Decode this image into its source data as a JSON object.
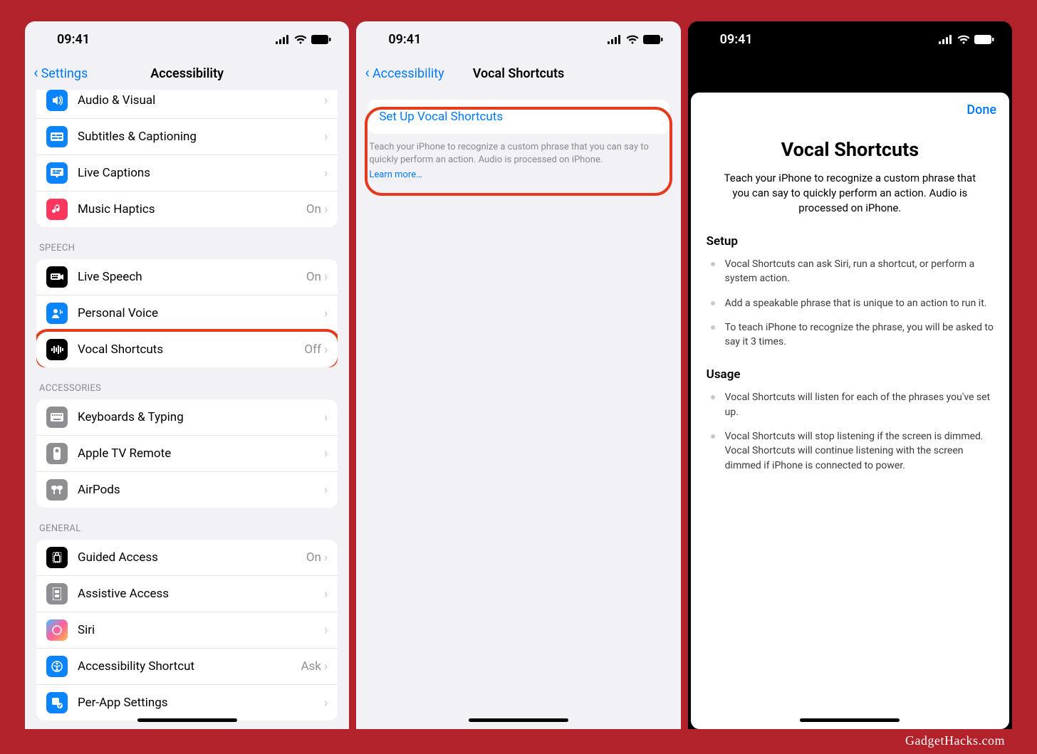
{
  "status": {
    "time": "09:41"
  },
  "watermark": "GadgetHacks.com",
  "phone1": {
    "back": "Settings",
    "title": "Accessibility",
    "truncated_row": {
      "label": "Audio & Visual"
    },
    "rows_top": [
      {
        "icon": "captions-icon",
        "label": "Subtitles & Captioning",
        "value": ""
      },
      {
        "icon": "live-captions-icon",
        "label": "Live Captions",
        "value": ""
      },
      {
        "icon": "music-haptics-icon",
        "label": "Music Haptics",
        "value": "On"
      }
    ],
    "speech_header": "SPEECH",
    "speech_rows": [
      {
        "icon": "live-speech-icon",
        "label": "Live Speech",
        "value": "On"
      },
      {
        "icon": "personal-voice-icon",
        "label": "Personal Voice",
        "value": ""
      },
      {
        "icon": "vocal-shortcuts-icon",
        "label": "Vocal Shortcuts",
        "value": "Off",
        "highlight": true
      }
    ],
    "accessories_header": "ACCESSORIES",
    "accessories_rows": [
      {
        "icon": "keyboard-icon",
        "label": "Keyboards & Typing",
        "value": ""
      },
      {
        "icon": "remote-icon",
        "label": "Apple TV Remote",
        "value": ""
      },
      {
        "icon": "airpods-icon",
        "label": "AirPods",
        "value": ""
      }
    ],
    "general_header": "GENERAL",
    "general_rows": [
      {
        "icon": "guided-access-icon",
        "label": "Guided Access",
        "value": "On"
      },
      {
        "icon": "assistive-access-icon",
        "label": "Assistive Access",
        "value": ""
      },
      {
        "icon": "siri-icon",
        "label": "Siri",
        "value": ""
      },
      {
        "icon": "accessibility-shortcut-icon",
        "label": "Accessibility Shortcut",
        "value": "Ask"
      },
      {
        "icon": "per-app-icon",
        "label": "Per-App Settings",
        "value": ""
      }
    ]
  },
  "phone2": {
    "back": "Accessibility",
    "title": "Vocal Shortcuts",
    "setup_label": "Set Up Vocal Shortcuts",
    "footer": "Teach your iPhone to recognize a custom phrase that you can say to quickly perform an action. Audio is processed on iPhone.",
    "learn_more": "Learn more…"
  },
  "phone3": {
    "done": "Done",
    "title": "Vocal Shortcuts",
    "subtitle": "Teach your iPhone to recognize a custom phrase that you can say to quickly perform an action. Audio is processed on iPhone.",
    "setup_header": "Setup",
    "setup_items": [
      "Vocal Shortcuts can ask Siri, run a shortcut, or perform a system action.",
      "Add a speakable phrase that is unique to an action to run it.",
      "To teach iPhone to recognize the phrase, you will be asked to say it 3 times."
    ],
    "usage_header": "Usage",
    "usage_items": [
      "Vocal Shortcuts will listen for each of the phrases you've set up.",
      "Vocal Shortcuts will stop listening if the screen is dimmed. Vocal Shortcuts will continue listening with the screen dimmed if iPhone is connected to power."
    ]
  }
}
